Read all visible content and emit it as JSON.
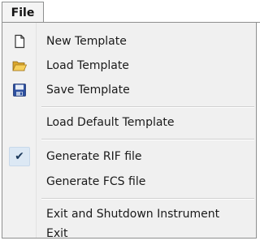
{
  "menubar": {
    "file_label": "File"
  },
  "menu": {
    "items": [
      {
        "label": "New Template",
        "icon": "new-document-icon"
      },
      {
        "label": "Load Template",
        "icon": "open-folder-icon"
      },
      {
        "label": "Save Template",
        "icon": "floppy-disk-icon"
      },
      {
        "label": "Load Default Template"
      },
      {
        "label": "Generate RIF file",
        "checked": true
      },
      {
        "label": "Generate FCS file",
        "checked": false
      },
      {
        "label": "Exit and Shutdown Instrument"
      },
      {
        "label": "Exit"
      }
    ],
    "check_glyph": "✔"
  }
}
